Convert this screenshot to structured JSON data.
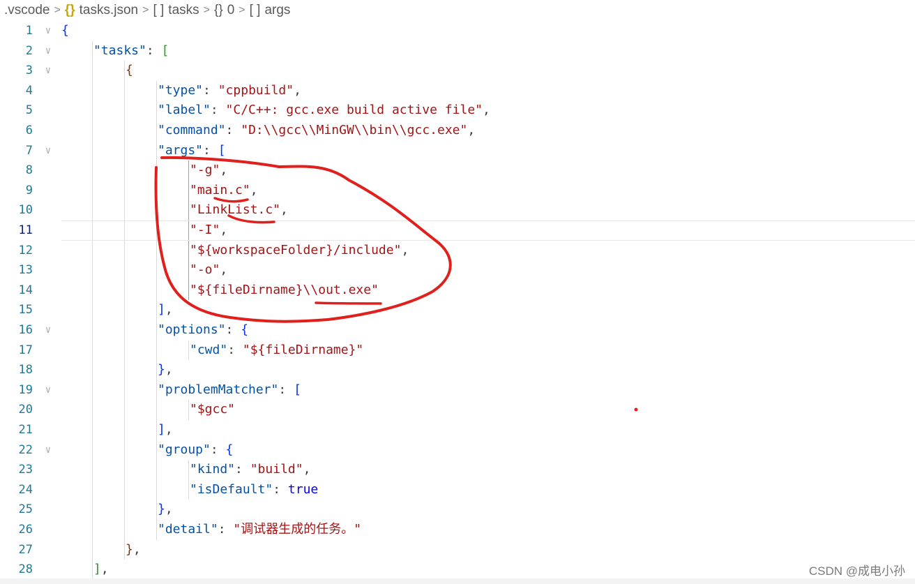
{
  "breadcrumb": [
    {
      "label": ".vscode",
      "icon": ""
    },
    {
      "label": "tasks.json",
      "icon": "{}"
    },
    {
      "label": "tasks",
      "icon": "[ ]"
    },
    {
      "label": "0",
      "icon": "{}"
    },
    {
      "label": "args",
      "icon": "[ ]"
    }
  ],
  "separator": ">",
  "current_line": 11,
  "lines": [
    {
      "n": "1",
      "indent": 0,
      "fold": true,
      "tokens": [
        [
          "b1",
          "{"
        ]
      ]
    },
    {
      "n": "2",
      "indent": 1,
      "fold": true,
      "tokens": [
        [
          "k",
          "\"tasks\""
        ],
        [
          "p",
          ": "
        ],
        [
          "b2",
          "["
        ]
      ]
    },
    {
      "n": "3",
      "indent": 2,
      "fold": true,
      "tokens": [
        [
          "b3",
          "{"
        ]
      ]
    },
    {
      "n": "4",
      "indent": 3,
      "fold": false,
      "tokens": [
        [
          "k",
          "\"type\""
        ],
        [
          "p",
          ": "
        ],
        [
          "s",
          "\"cppbuild\""
        ],
        [
          "p",
          ","
        ]
      ]
    },
    {
      "n": "5",
      "indent": 3,
      "fold": false,
      "tokens": [
        [
          "k",
          "\"label\""
        ],
        [
          "p",
          ": "
        ],
        [
          "s",
          "\"C/C++: gcc.exe build active file\""
        ],
        [
          "p",
          ","
        ]
      ]
    },
    {
      "n": "6",
      "indent": 3,
      "fold": false,
      "tokens": [
        [
          "k",
          "\"command\""
        ],
        [
          "p",
          ": "
        ],
        [
          "s",
          "\"D:\\\\gcc\\\\MinGW\\\\bin\\\\gcc.exe\""
        ],
        [
          "p",
          ","
        ]
      ]
    },
    {
      "n": "7",
      "indent": 3,
      "fold": true,
      "tokens": [
        [
          "k",
          "\"args\""
        ],
        [
          "p",
          ": "
        ],
        [
          "b1",
          "["
        ]
      ]
    },
    {
      "n": "8",
      "indent": 4,
      "fold": false,
      "tokens": [
        [
          "s",
          "\"-g\""
        ],
        [
          "p",
          ","
        ]
      ]
    },
    {
      "n": "9",
      "indent": 4,
      "fold": false,
      "tokens": [
        [
          "s",
          "\"main.c\""
        ],
        [
          "p",
          ","
        ]
      ]
    },
    {
      "n": "10",
      "indent": 4,
      "fold": false,
      "tokens": [
        [
          "s",
          "\"LinkList.c\""
        ],
        [
          "p",
          ","
        ]
      ]
    },
    {
      "n": "11",
      "indent": 4,
      "fold": false,
      "tokens": [
        [
          "s",
          "\"-I\""
        ],
        [
          "p",
          ","
        ]
      ]
    },
    {
      "n": "12",
      "indent": 4,
      "fold": false,
      "tokens": [
        [
          "s",
          "\"${workspaceFolder}/include\""
        ],
        [
          "p",
          ","
        ]
      ]
    },
    {
      "n": "13",
      "indent": 4,
      "fold": false,
      "tokens": [
        [
          "s",
          "\"-o\""
        ],
        [
          "p",
          ","
        ]
      ]
    },
    {
      "n": "14",
      "indent": 4,
      "fold": false,
      "tokens": [
        [
          "s",
          "\"${fileDirname}\\\\out.exe\""
        ]
      ]
    },
    {
      "n": "15",
      "indent": 3,
      "fold": false,
      "tokens": [
        [
          "b1",
          "]"
        ],
        [
          "p",
          ","
        ]
      ]
    },
    {
      "n": "16",
      "indent": 3,
      "fold": true,
      "tokens": [
        [
          "k",
          "\"options\""
        ],
        [
          "p",
          ": "
        ],
        [
          "b1",
          "{"
        ]
      ]
    },
    {
      "n": "17",
      "indent": 4,
      "fold": false,
      "tokens": [
        [
          "k",
          "\"cwd\""
        ],
        [
          "p",
          ": "
        ],
        [
          "s",
          "\"${fileDirname}\""
        ]
      ]
    },
    {
      "n": "18",
      "indent": 3,
      "fold": false,
      "tokens": [
        [
          "b1",
          "}"
        ],
        [
          "p",
          ","
        ]
      ]
    },
    {
      "n": "19",
      "indent": 3,
      "fold": true,
      "tokens": [
        [
          "k",
          "\"problemMatcher\""
        ],
        [
          "p",
          ": "
        ],
        [
          "b1",
          "["
        ]
      ]
    },
    {
      "n": "20",
      "indent": 4,
      "fold": false,
      "tokens": [
        [
          "s",
          "\"$gcc\""
        ]
      ]
    },
    {
      "n": "21",
      "indent": 3,
      "fold": false,
      "tokens": [
        [
          "b1",
          "]"
        ],
        [
          "p",
          ","
        ]
      ]
    },
    {
      "n": "22",
      "indent": 3,
      "fold": true,
      "tokens": [
        [
          "k",
          "\"group\""
        ],
        [
          "p",
          ": "
        ],
        [
          "b1",
          "{"
        ]
      ]
    },
    {
      "n": "23",
      "indent": 4,
      "fold": false,
      "tokens": [
        [
          "k",
          "\"kind\""
        ],
        [
          "p",
          ": "
        ],
        [
          "s",
          "\"build\""
        ],
        [
          "p",
          ","
        ]
      ]
    },
    {
      "n": "24",
      "indent": 4,
      "fold": false,
      "tokens": [
        [
          "k",
          "\"isDefault\""
        ],
        [
          "p",
          ": "
        ],
        [
          "kw",
          "true"
        ]
      ]
    },
    {
      "n": "25",
      "indent": 3,
      "fold": false,
      "tokens": [
        [
          "b1",
          "}"
        ],
        [
          "p",
          ","
        ]
      ]
    },
    {
      "n": "26",
      "indent": 3,
      "fold": false,
      "tokens": [
        [
          "k",
          "\"detail\""
        ],
        [
          "p",
          ": "
        ],
        [
          "s",
          "\"调试器生成的任务。\""
        ]
      ]
    },
    {
      "n": "27",
      "indent": 2,
      "fold": false,
      "tokens": [
        [
          "b3",
          "}"
        ],
        [
          "p",
          ","
        ]
      ]
    },
    {
      "n": "28",
      "indent": 1,
      "fold": false,
      "tokens": [
        [
          "b2",
          "]"
        ],
        [
          "p",
          ","
        ]
      ]
    }
  ],
  "watermark": "CSDN @成电小孙",
  "annotation_color": "#e0201c"
}
